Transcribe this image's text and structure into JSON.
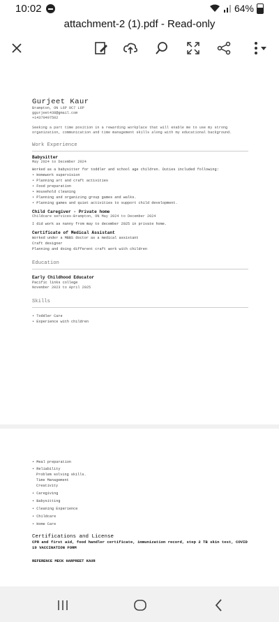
{
  "status_bar": {
    "time": "10:02",
    "battery": "64%"
  },
  "app": {
    "title": "attachment-2 (1).pdf - Read-only"
  },
  "toolbar_icons": [
    "close-icon",
    "edit-icon",
    "upload-cloud-icon",
    "search-icon",
    "fullscreen-icon",
    "share-icon",
    "more-icon",
    "dropdown-icon"
  ],
  "resume": {
    "name": "Gurjeet Kaur",
    "contact": [
      "Brampton, ON L6P 0C7 L6P",
      "ggurjeet438@gmail.com",
      "+14370497502"
    ],
    "summary": "Seeking a part time position in a rewarding workplace that will enable me to use my strong organization, communication and time management skills along with my educational background.",
    "work_heading": "Work Experience",
    "jobs": [
      {
        "title": "Babysitter",
        "meta": "May 2024 to December 2024",
        "desc": "Worked as a babysitter for toddler and school age children. Duties included following:",
        "bullets": [
          "Homework supervision",
          "Planning art and craft activities",
          "Food preparation",
          "Household cleaning",
          "Planning and organizing group games and walks.",
          "Planning games and quiet activities to support child development."
        ]
      },
      {
        "title": "Child Caregiver - Private home",
        "meta": "Childcare services-Brampton, ON May 2024 to December 2024",
        "desc": "I did work as nanny from may to december 2025 in private home.",
        "bullets": []
      },
      {
        "title": "Certificate of Medical Assistant",
        "meta": "",
        "desc": "Worked under a MBBS doctor as a medical assistant",
        "bullets": [
          "Craft designer",
          "Planning and doing different craft work with children"
        ]
      }
    ],
    "education_heading": "Education",
    "education": {
      "title": "Early Childhood Educator",
      "school": "Pacific links college",
      "dates": "November 2023 to April 2025"
    },
    "skills_heading": "Skills",
    "skills": [
      "Toddler Care",
      "Experience with children"
    ],
    "page2_skills": [
      "Meal preparation",
      "Reliability",
      "Problem solving skills.",
      "Time Management",
      "Creativity",
      "Caregiving",
      "Babysitting",
      "Cleaning Experience",
      "Childcare",
      "Home Care"
    ],
    "cert_heading": "Certifications and License",
    "cert_text": "CPR and first aid, food handler certificate, immunization record, step 2 TB skin test, COVID 19 VACCINATION FORM",
    "reference": "REFERENCE MECK HARPREET KAUR"
  }
}
